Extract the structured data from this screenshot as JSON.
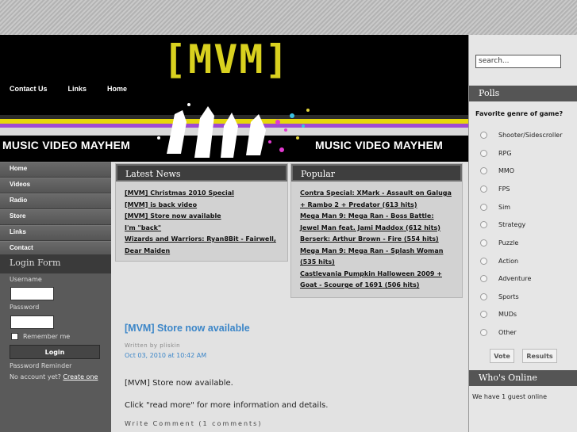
{
  "header": {
    "logo": "[MVM]",
    "nav": [
      "Contact Us",
      "Links",
      "Home"
    ],
    "tagline_left": "MUSIC VIDEO MAYHEM",
    "tagline_right": "MUSIC VIDEO MAYHEM"
  },
  "left_nav": [
    "Home",
    "Videos",
    "Radio",
    "Store",
    "Links",
    "Contact"
  ],
  "login": {
    "title": "Login Form",
    "username_label": "Username",
    "password_label": "Password",
    "remember_label": "Remember me",
    "button": "Login",
    "password_reminder": "Password Reminder",
    "no_account": "No account yet?",
    "create_link": "Create one"
  },
  "latest_news": {
    "title": "Latest News",
    "items": [
      "[MVM] Christmas 2010 Special",
      "[MVM] is back video",
      "[MVM] Store now available",
      "I'm \"back\"",
      "Wizards and Warriors: Ryan8Bit - Fairwell, Dear Maiden"
    ]
  },
  "popular": {
    "title": "Popular",
    "items": [
      {
        "link": "Contra Special: XMark - Assault on Galuga + Rambo 2 + Predator",
        "hits": "(613 hits)"
      },
      {
        "link": "Mega Man 9: Mega Ran - Boss Battle: Jewel Man feat. Jami Maddox",
        "hits": "(612 hits)"
      },
      {
        "link": "Berserk: Arthur Brown - Fire",
        "hits": "(554 hits)"
      },
      {
        "link": "Mega Man 9: Mega Ran - Splash Woman",
        "hits": "(535 hits)"
      },
      {
        "link": "Castlevania Pumpkin Halloween 2009 + Goat - Scourge of 1691",
        "hits": "(506 hits)"
      }
    ]
  },
  "article": {
    "title": "[MVM] Store now available",
    "author": "Written by pliskin",
    "date": "Oct 03, 2010 at 10:42 AM",
    "paragraph1": "[MVM] Store now available.",
    "paragraph2": "Click \"read more\" for more information and details.",
    "write_comment": "Write Comment (1 comments)"
  },
  "search": {
    "placeholder": "search..."
  },
  "polls": {
    "title": "Polls",
    "question": "Favorite genre of game?",
    "options": [
      "Shooter/Sidescroller",
      "RPG",
      "MMO",
      "FPS",
      "Sim",
      "Strategy",
      "Puzzle",
      "Action",
      "Adventure",
      "Sports",
      "MUDs",
      "Other"
    ],
    "vote": "Vote",
    "results": "Results"
  },
  "whos_online": {
    "title": "Who's Online",
    "text": "We have 1 guest online"
  },
  "colors": {
    "accent_blue": "#3c86c8",
    "logo_yellow": "#d9d11f",
    "header_black": "#000000"
  }
}
